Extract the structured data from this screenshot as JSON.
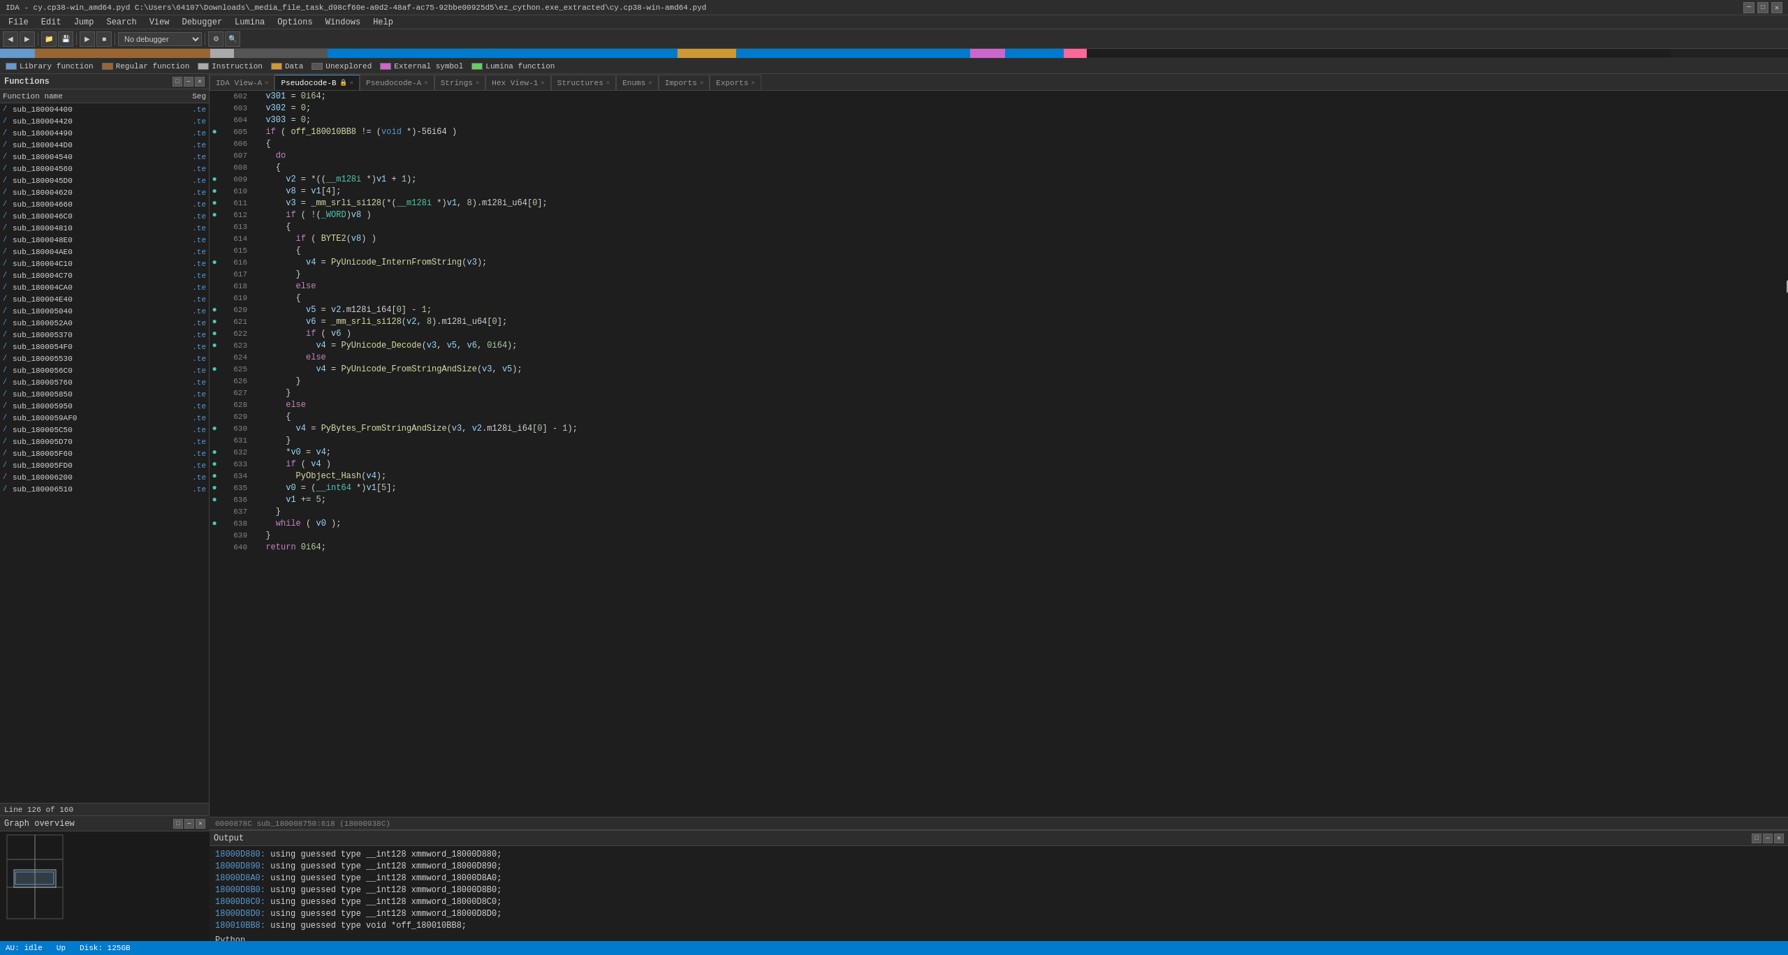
{
  "title": "IDA - cy.cp38-win_amd64.pyd C:\\Users\\64107\\Downloads\\_media_file_task_d98cf60e-a0d2-48af-ac75-92bbe00925d5\\ez_cython.exe_extracted\\cy.cp38-win-amd64.pyd",
  "menu": {
    "items": [
      "File",
      "Edit",
      "Jump",
      "Search",
      "View",
      "Debugger",
      "Lumina",
      "Options",
      "Windows",
      "Help"
    ]
  },
  "toolbar": {
    "debugger_label": "No debugger"
  },
  "legend": {
    "items": [
      {
        "label": "Library function",
        "color": "#6699cc"
      },
      {
        "label": "Regular function",
        "color": "#996633"
      },
      {
        "label": "Instruction",
        "color": "#aaaaaa"
      },
      {
        "label": "Data",
        "color": "#cc9933"
      },
      {
        "label": "Unexplored",
        "color": "#555555"
      },
      {
        "label": "External symbol",
        "color": "#cc66cc"
      },
      {
        "label": "Lumina function",
        "color": "#66cc66"
      }
    ]
  },
  "functions_panel": {
    "title": "Functions",
    "col_name": "Function name",
    "col_seg": "Seg",
    "items": [
      {
        "name": "sub_180004400",
        "seg": ".te"
      },
      {
        "name": "sub_180004420",
        "seg": ".te"
      },
      {
        "name": "sub_180004490",
        "seg": ".te"
      },
      {
        "name": "sub_1800044D0",
        "seg": ".te"
      },
      {
        "name": "sub_180004540",
        "seg": ".te"
      },
      {
        "name": "sub_180004560",
        "seg": ".te"
      },
      {
        "name": "sub_1800045D0",
        "seg": ".te"
      },
      {
        "name": "sub_180004620",
        "seg": ".te"
      },
      {
        "name": "sub_180004660",
        "seg": ".te"
      },
      {
        "name": "sub_1800046C0",
        "seg": ".te"
      },
      {
        "name": "sub_180004810",
        "seg": ".te"
      },
      {
        "name": "sub_1800048E0",
        "seg": ".te"
      },
      {
        "name": "sub_180004AE0",
        "seg": ".te"
      },
      {
        "name": "sub_180004C10",
        "seg": ".te"
      },
      {
        "name": "sub_180004C70",
        "seg": ".te"
      },
      {
        "name": "sub_180004CA0",
        "seg": ".te"
      },
      {
        "name": "sub_180004E40",
        "seg": ".te"
      },
      {
        "name": "sub_180005040",
        "seg": ".te"
      },
      {
        "name": "sub_1800052A0",
        "seg": ".te"
      },
      {
        "name": "sub_180005370",
        "seg": ".te"
      },
      {
        "name": "sub_1800054F0",
        "seg": ".te"
      },
      {
        "name": "sub_180005530",
        "seg": ".te"
      },
      {
        "name": "sub_1800056C0",
        "seg": ".te"
      },
      {
        "name": "sub_180005760",
        "seg": ".te"
      },
      {
        "name": "sub_180005850",
        "seg": ".te"
      },
      {
        "name": "sub_180005950",
        "seg": ".te"
      },
      {
        "name": "sub_1800059AF0",
        "seg": ".te"
      },
      {
        "name": "sub_180005C50",
        "seg": ".te"
      },
      {
        "name": "sub_180005D70",
        "seg": ".te"
      },
      {
        "name": "sub_180005F60",
        "seg": ".te"
      },
      {
        "name": "sub_180005FD0",
        "seg": ".te"
      },
      {
        "name": "sub_180006200",
        "seg": ".te"
      },
      {
        "name": "sub_180006510",
        "seg": ".te"
      }
    ],
    "line_info": "Line 126 of 160"
  },
  "graph_panel": {
    "title": "Graph overview"
  },
  "tabs": [
    {
      "label": "IDA View-A",
      "active": false,
      "locked": false
    },
    {
      "label": "Pseudocode-B",
      "active": true,
      "locked": true
    },
    {
      "label": "Pseudocode-A",
      "active": false,
      "locked": false
    },
    {
      "label": "Strings",
      "active": false,
      "locked": false
    },
    {
      "label": "Hex View-1",
      "active": false,
      "locked": false
    },
    {
      "label": "Structures",
      "active": false,
      "locked": false
    },
    {
      "label": "Enums",
      "active": false,
      "locked": false
    },
    {
      "label": "Imports",
      "active": false,
      "locked": false
    },
    {
      "label": "Exports",
      "active": false,
      "locked": false
    }
  ],
  "code": {
    "lines": [
      {
        "num": 602,
        "dot": false,
        "text": "  v301 = 0i64;"
      },
      {
        "num": 603,
        "dot": false,
        "text": "  v302 = 0;"
      },
      {
        "num": 604,
        "dot": false,
        "text": "  v303 = 0;"
      },
      {
        "num": 605,
        "dot": true,
        "text": "  if ( off_180010BB8 != (void *)-56i64 )"
      },
      {
        "num": 606,
        "dot": false,
        "text": "  {"
      },
      {
        "num": 607,
        "dot": false,
        "text": "    do"
      },
      {
        "num": 608,
        "dot": false,
        "text": "    {"
      },
      {
        "num": 609,
        "dot": true,
        "text": "      v2 = *((__m128i *)v1 + 1);"
      },
      {
        "num": 610,
        "dot": true,
        "text": "      v8 = v1[4];"
      },
      {
        "num": 611,
        "dot": true,
        "text": "      v3 = _mm_srli_si128(*(__m128i *)v1, 8).m128i_u64[0];"
      },
      {
        "num": 612,
        "dot": true,
        "text": "      if ( !(_WORD)v8 )"
      },
      {
        "num": 613,
        "dot": false,
        "text": "      {"
      },
      {
        "num": 614,
        "dot": false,
        "text": "        if ( BYTE2(v8) )"
      },
      {
        "num": 615,
        "dot": false,
        "text": "        {"
      },
      {
        "num": 616,
        "dot": true,
        "text": "          v4 = PyUnicode_InternFromString(v3);"
      },
      {
        "num": 617,
        "dot": false,
        "text": "        }"
      },
      {
        "num": 618,
        "dot": false,
        "text": "        else"
      },
      {
        "num": 619,
        "dot": false,
        "text": "        {"
      },
      {
        "num": 620,
        "dot": true,
        "text": "          v5 = v2.m128i_i64[0] - 1;"
      },
      {
        "num": 621,
        "dot": true,
        "text": "          v6 = _mm_srli_si128(v2, 8).m128i_u64[0];"
      },
      {
        "num": 622,
        "dot": true,
        "text": "          if ( v6 )"
      },
      {
        "num": 623,
        "dot": true,
        "text": "            v4 = PyUnicode_Decode(v3, v5, v6, 0i64);"
      },
      {
        "num": 624,
        "dot": false,
        "text": "          else"
      },
      {
        "num": 625,
        "dot": true,
        "text": "            v4 = PyUnicode_FromStringAndSize(v3, v5);"
      },
      {
        "num": 626,
        "dot": false,
        "text": "        }"
      },
      {
        "num": 627,
        "dot": false,
        "text": "      }"
      },
      {
        "num": 628,
        "dot": false,
        "text": "      else"
      },
      {
        "num": 629,
        "dot": false,
        "text": "      {"
      },
      {
        "num": 630,
        "dot": true,
        "text": "        v4 = PyBytes_FromStringAndSize(v3, v2.m128i_i64[0] - 1);"
      },
      {
        "num": 631,
        "dot": false,
        "text": "      }"
      },
      {
        "num": 632,
        "dot": true,
        "text": "      *v0 = v4;"
      },
      {
        "num": 633,
        "dot": true,
        "text": "      if ( v4 )"
      },
      {
        "num": 634,
        "dot": true,
        "text": "        PyObject_Hash(v4);"
      },
      {
        "num": 635,
        "dot": true,
        "text": "      v0 = (__int64 *)v1[5];"
      },
      {
        "num": 636,
        "dot": true,
        "text": "      v1 += 5;"
      },
      {
        "num": 637,
        "dot": false,
        "text": "    }"
      },
      {
        "num": 638,
        "dot": true,
        "text": "    while ( v0 );"
      },
      {
        "num": 639,
        "dot": false,
        "text": "  }"
      },
      {
        "num": 640,
        "dot": false,
        "text": "  return 0i64;"
      }
    ],
    "status": "0000878C sub_180008750:618 (18000938C)"
  },
  "output_panel": {
    "title": "Output",
    "lines": [
      {
        "addr": "18000D880:",
        "text": " using guessed type __int128 xmmword_18000D880;"
      },
      {
        "addr": "18000D890:",
        "text": " using guessed type __int128 xmmword_18000D890;"
      },
      {
        "addr": "18000D8A0:",
        "text": " using guessed type __int128 xmmword_18000D8A0;"
      },
      {
        "addr": "18000D8B0:",
        "text": " using guessed type __int128 xmmword_18000D8B0;"
      },
      {
        "addr": "18000D8C0:",
        "text": " using guessed type __int128 xmmword_18000D8C0;"
      },
      {
        "addr": "18000D8D0:",
        "text": " using guessed type __int128 xmmword_18000D8D0;"
      },
      {
        "addr": "180010BB8:",
        "text": " using guessed type void *off_180010BB8;"
      }
    ],
    "python_label": "Python"
  },
  "status_bar": {
    "au": "AU:",
    "idle": "idle",
    "up": "Up",
    "disk": "Disk: 125GB"
  }
}
